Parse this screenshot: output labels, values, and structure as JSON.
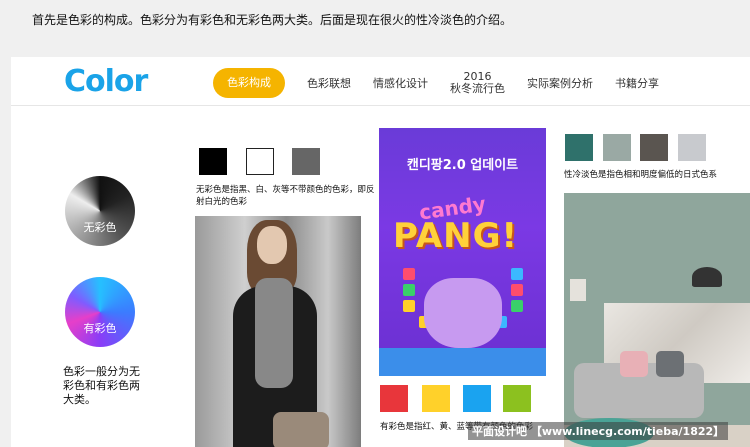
{
  "intro_text": "首先是色彩的构成。色彩分为有彩色和无彩色两大类。后面是现在很火的性冷淡色的介绍。",
  "logo": "Color",
  "nav": {
    "items": [
      {
        "label": "色彩构成",
        "active": true
      },
      {
        "label": "色彩联想"
      },
      {
        "label": "情感化设计"
      },
      {
        "label_line1": "2016",
        "label_line2": "秋冬流行色"
      },
      {
        "label": "实际案例分析"
      },
      {
        "label": "书籍分享"
      }
    ]
  },
  "wheels": {
    "achromatic_label": "无彩色",
    "chromatic_label": "有彩色"
  },
  "left_desc": "色彩一般分为无彩色和有彩色两大类。",
  "achromatic": {
    "swatches": [
      "#000000",
      "#ffffff",
      "#666666"
    ],
    "desc": "无彩色是指黑、白、灰等不带颜色的色彩，即反射白光的色彩"
  },
  "game_image": {
    "title": "캔디팡2.0 업데이트",
    "candy": "candy",
    "pang": "PANG!"
  },
  "chromatic": {
    "swatches": [
      "#e8363b",
      "#ffd12a",
      "#1aa3f0",
      "#8cc11f"
    ],
    "desc": "有彩色是指红、黄、蓝等带有颜色的色彩"
  },
  "cool": {
    "swatches": [
      "#2f716b",
      "#9aa9a4",
      "#5a5550",
      "#c8cace"
    ],
    "desc": "性冷淡色是指色相和明度偏低的日式色系"
  },
  "watermark": "平面设计吧 【www.linecg.com/tieba/1822】",
  "colors": {
    "accent": "#f5b400",
    "logo": "#1aa3e8"
  }
}
